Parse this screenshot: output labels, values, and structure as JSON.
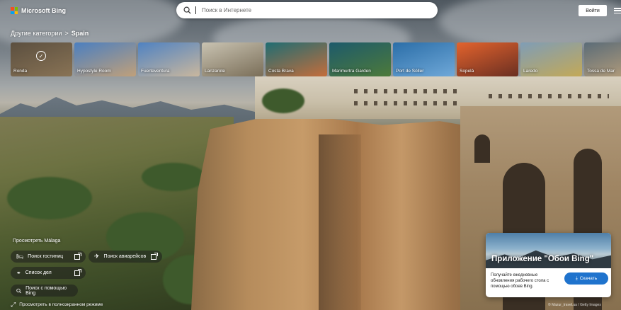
{
  "header": {
    "brand": "Microsoft Bing",
    "search_placeholder": "Поиск в Интернете",
    "signin_label": "Войти",
    "logo_colors": [
      "#f25022",
      "#7fba00",
      "#00a4ef",
      "#ffb900"
    ]
  },
  "categories": {
    "parent": "Другие категории",
    "separator": ">",
    "current": "Spain",
    "tiles": [
      {
        "label": "Ronda",
        "selected": true,
        "c1": "#7a6a55",
        "c2": "#b79a72"
      },
      {
        "label": "Hypostyle Room",
        "selected": false,
        "c1": "#4b7fc0",
        "c2": "#c0a07a"
      },
      {
        "label": "Fuerteventura",
        "selected": false,
        "c1": "#4f82c2",
        "c2": "#c9b79e"
      },
      {
        "label": "Lanzarote",
        "selected": false,
        "c1": "#c9c3b2",
        "c2": "#7a6e58"
      },
      {
        "label": "Costa Brava",
        "selected": false,
        "c1": "#1f6d73",
        "c2": "#c46d3b"
      },
      {
        "label": "Marimurtra Garden",
        "selected": false,
        "c1": "#1d5a6b",
        "c2": "#4d7a3a"
      },
      {
        "label": "Port de Sóller",
        "selected": false,
        "c1": "#2b6ea8",
        "c2": "#6fa8d8"
      },
      {
        "label": "Sopelá",
        "selected": false,
        "c1": "#e3632d",
        "c2": "#6a2f22"
      },
      {
        "label": "Laredo",
        "selected": false,
        "c1": "#7f9db6",
        "c2": "#c3a957"
      },
      {
        "label": "Tossa de Mar",
        "selected": false,
        "c1": "#5b6c78",
        "c2": "#b19b7a"
      }
    ]
  },
  "explore": {
    "title": "Просмотреть Málaga",
    "hotels_label": "Поиск гостиниц",
    "flights_label": "Поиск авиарейсов",
    "todo_label": "Список дел",
    "bing_help_label": "Поиск с помощью Bing",
    "fullscreen_label": "Просмотреть в полноэкранном режиме"
  },
  "app_card": {
    "title": "Приложение \"Обои Bing\"",
    "description": "Получайте ежедневные обновления рабочего стола с помощью обоев Bing.",
    "download_label": "Скачать",
    "accent_color": "#1f73cd"
  },
  "credit": "© Mazur_travel.ua / Getty Images"
}
